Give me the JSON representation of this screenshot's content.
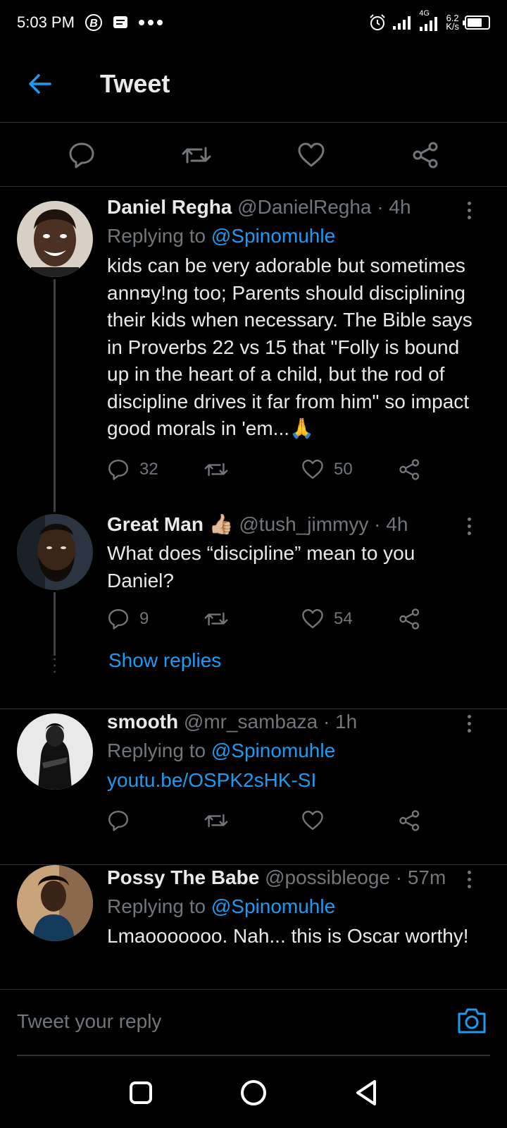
{
  "status_bar": {
    "time": "5:03 PM",
    "network_type": "4G",
    "net_speed_value": "6.2",
    "net_speed_unit": "K/s",
    "battery_level": 0.7,
    "icons": [
      "bitcoin-icon",
      "message-icon",
      "more-dots-icon",
      "alarm-icon",
      "signal-icon",
      "battery-icon"
    ]
  },
  "header": {
    "title": "Tweet"
  },
  "action_bar": {
    "icons": [
      "reply-icon",
      "retweet-icon",
      "like-icon",
      "share-icon"
    ]
  },
  "tweets": [
    {
      "name": "Daniel Regha",
      "handle": "@DanielRegha",
      "separator": "·",
      "time": "4h",
      "replying_prefix": "Replying to",
      "replying_to": "@Spinomuhle",
      "text": "kids can be very adorable but sometimes ann¤y!ng too; Parents should disciplining their kids when necessary. The Bible says in Proverbs 22 vs 15 that \"Folly is bound up in the heart of a child, but the rod of discipline drives it far from him\" so impact good morals in 'em...🙏",
      "replies": "32",
      "retweets": "",
      "likes": "50"
    },
    {
      "name": "Great Man",
      "name_emoji": "👍🏼",
      "handle": "@tush_jimmyy",
      "separator": "·",
      "time": "4h",
      "text": "What does “discipline” mean to you Daniel?",
      "replies": "9",
      "retweets": "",
      "likes": "54",
      "show_replies": "Show replies"
    },
    {
      "name": "smooth",
      "handle": "@mr_sambaza",
      "separator": "·",
      "time": "1h",
      "replying_prefix": "Replying to",
      "replying_to": "@Spinomuhle",
      "link": "youtu.be/OSPK2sHK-SI",
      "replies": "",
      "retweets": "",
      "likes": ""
    },
    {
      "name": "Possy The Babe",
      "handle": "@possibleoge",
      "separator": "·",
      "time": "57m",
      "replying_prefix": "Replying to",
      "replying_to": "@Spinomuhle",
      "text": "Lmaooooooo. Nah... this is Oscar worthy!"
    }
  ],
  "reply_bar": {
    "placeholder": "Tweet your reply"
  },
  "colors": {
    "accent": "#1d9bf0",
    "muted": "#71767b",
    "background": "#000000",
    "divider": "#2f3336"
  }
}
